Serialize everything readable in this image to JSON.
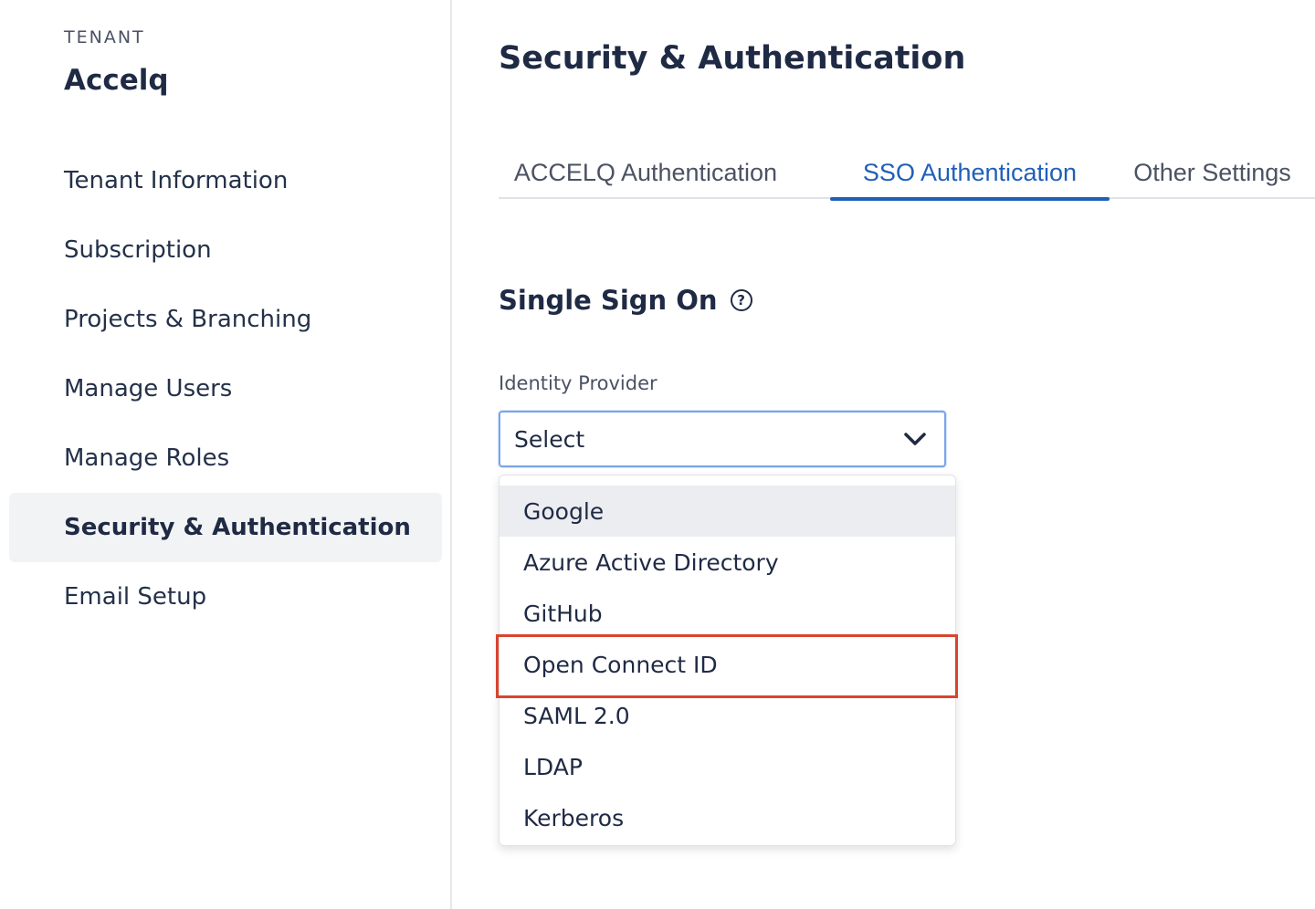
{
  "sidebar": {
    "tenant_label": "TENANT",
    "tenant_name": "Accelq",
    "items": [
      {
        "label": "Tenant Information"
      },
      {
        "label": "Subscription"
      },
      {
        "label": "Projects & Branching"
      },
      {
        "label": "Manage Users"
      },
      {
        "label": "Manage Roles"
      },
      {
        "label": "Security & Authentication",
        "active": true
      },
      {
        "label": "Email Setup"
      }
    ]
  },
  "main": {
    "title": "Security & Authentication",
    "tabs": [
      {
        "label": "ACCELQ Authentication"
      },
      {
        "label": "SSO Authentication",
        "active": true
      },
      {
        "label": "Other Settings"
      }
    ],
    "section_title": "Single Sign On",
    "help_icon": "question-circle-icon",
    "identity_provider": {
      "label": "Identity Provider",
      "value": "Select",
      "options": [
        "Google",
        "Azure Active Directory",
        "GitHub",
        "Open Connect ID",
        "SAML 2.0",
        "LDAP",
        "Kerberos"
      ],
      "hovered_option": "Google",
      "highlighted_option": "Open Connect ID"
    }
  },
  "colors": {
    "accent": "#1f5fb8",
    "highlight": "#d9432d",
    "active_nav_bg": "#f2f3f5"
  }
}
